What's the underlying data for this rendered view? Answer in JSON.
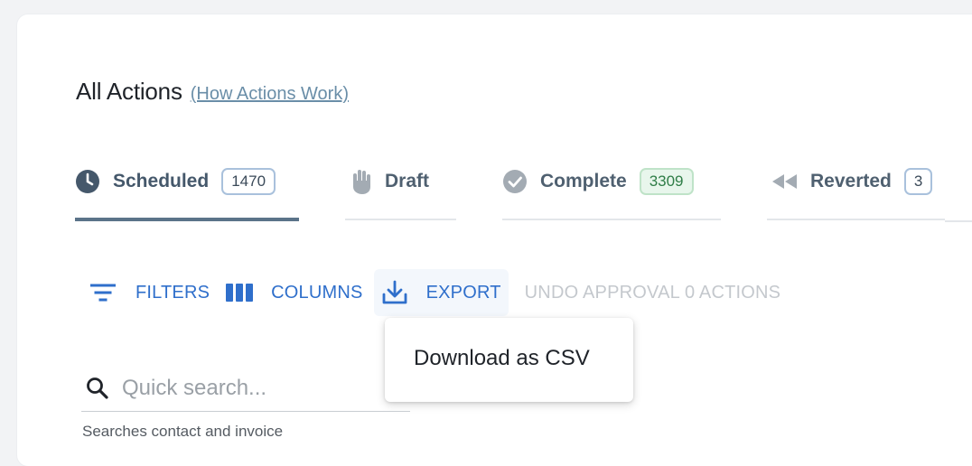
{
  "header": {
    "title": "All Actions",
    "help_link": "(How Actions Work)"
  },
  "tabs": [
    {
      "label": "Scheduled",
      "count": "1470",
      "icon": "clock-icon",
      "active": true
    },
    {
      "label": "Draft",
      "count": "",
      "icon": "hand-icon",
      "active": false
    },
    {
      "label": "Complete",
      "count": "3309",
      "icon": "check-circle-icon",
      "active": false
    },
    {
      "label": "Reverted",
      "count": "3",
      "icon": "rewind-icon",
      "active": false
    }
  ],
  "toolbar": {
    "filters_label": "FILTERS",
    "columns_label": "COLUMNS",
    "export_label": "EXPORT",
    "undo_label": "UNDO APPROVAL 0 ACTIONS"
  },
  "export_menu": {
    "items": [
      "Download as CSV"
    ]
  },
  "search": {
    "placeholder": "Quick search...",
    "value": "",
    "helper": "Searches contact and invoice"
  },
  "colors": {
    "accent": "#2f6fcb",
    "tab_active": "#5b7389",
    "badge_green_bg": "#e8f6ec",
    "badge_blue_border": "#a9c1dc"
  }
}
